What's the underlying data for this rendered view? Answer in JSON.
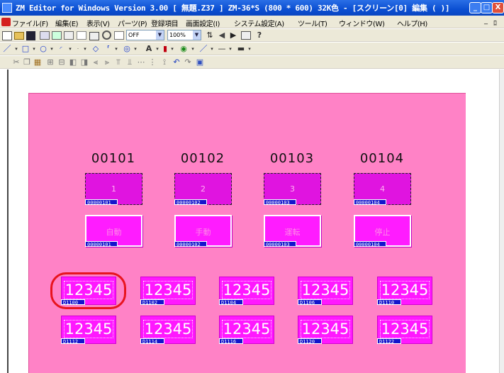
{
  "window": {
    "title": "ZM Editor for Windows Version 3.00 [ 無題.Z37 ] ZM-36*S (800 * 600) 32K色 - [スクリーン[0] 編集 (          )]",
    "controls": {
      "minimize": "_",
      "maximize": "□",
      "close": "X"
    }
  },
  "menu": {
    "items": [
      "ファイル(F)",
      "編集(E)",
      "表示(V)",
      "パーツ(P)",
      "登録項目",
      "画面設定(I)",
      "システム設定(A)",
      "ツール(T)",
      "ウィンドウ(W)",
      "ヘルプ(H)"
    ],
    "mdi_controls": {
      "minimize": "_",
      "restore": "ﾛ"
    }
  },
  "toolbar": {
    "toggle_combo": "OFF",
    "zoom_combo": "100%",
    "help_glyph": "?"
  },
  "screen": {
    "accent_bg": "#ff82c6",
    "numeric_labels": [
      "00101",
      "00102",
      "00103",
      "00104"
    ],
    "lamps": [
      {
        "label": "1",
        "tag": "00000101"
      },
      {
        "label": "2",
        "tag": "00000102"
      },
      {
        "label": "3",
        "tag": "00000103"
      },
      {
        "label": "4",
        "tag": "00000104"
      }
    ],
    "switches": [
      {
        "label": "自動",
        "tag": "00000101"
      },
      {
        "label": "手動",
        "tag": "00000102"
      },
      {
        "label": "運転",
        "tag": "00000103"
      },
      {
        "label": "停止",
        "tag": "00000104"
      }
    ],
    "displays_row1": [
      {
        "value": "12345",
        "tag": "D1100"
      },
      {
        "value": "12345",
        "tag": "D1102"
      },
      {
        "value": "12345",
        "tag": "D1104"
      },
      {
        "value": "12345",
        "tag": "D1106"
      },
      {
        "value": "12345",
        "tag": "D1110"
      }
    ],
    "displays_row2": [
      {
        "value": "12345",
        "tag": "D1112"
      },
      {
        "value": "12345",
        "tag": "D1114"
      },
      {
        "value": "12345",
        "tag": "D1116"
      },
      {
        "value": "12345",
        "tag": "D1120"
      },
      {
        "value": "12345",
        "tag": "D1122"
      }
    ]
  }
}
